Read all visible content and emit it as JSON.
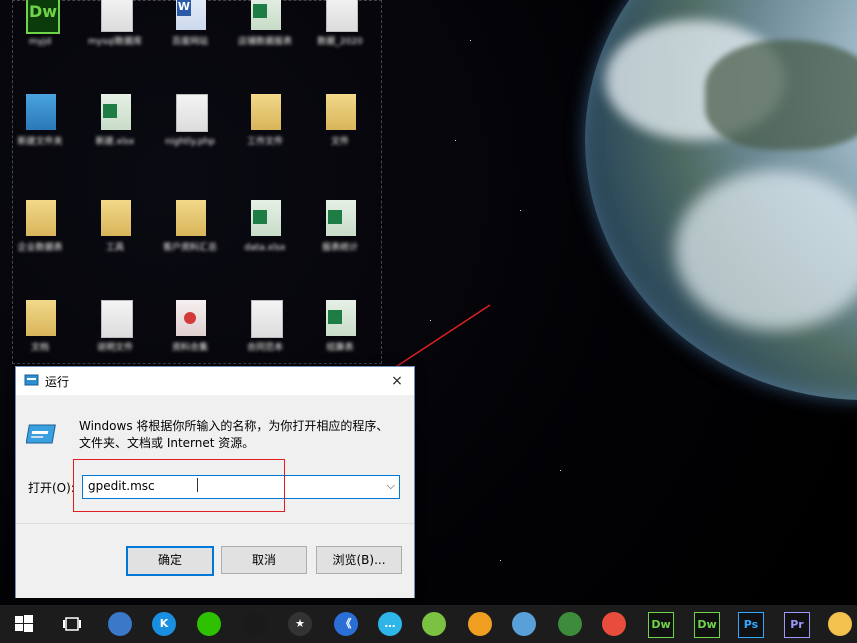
{
  "desktop": {
    "icons": [
      {
        "label": "myjd",
        "kind": "dw"
      },
      {
        "label": "mysql数据库",
        "kind": "doc"
      },
      {
        "label": "百度网站",
        "kind": "word"
      },
      {
        "label": "店铺数据报表",
        "kind": "xls"
      },
      {
        "label": "数据_2020",
        "kind": "doc"
      },
      {
        "label": "新建文件夹",
        "kind": "blue-folder"
      },
      {
        "label": "新建.xlsx",
        "kind": "xls"
      },
      {
        "label": "nightly.php",
        "kind": "doc"
      },
      {
        "label": "工作文件",
        "kind": "folder"
      },
      {
        "label": "文件",
        "kind": "folder"
      },
      {
        "label": "企业数据表",
        "kind": "folder"
      },
      {
        "label": "工具",
        "kind": "folder"
      },
      {
        "label": "客户资料汇总",
        "kind": "folder"
      },
      {
        "label": "data.xlsx",
        "kind": "xls"
      },
      {
        "label": "报表统计",
        "kind": "xls"
      },
      {
        "label": "文档",
        "kind": "folder"
      },
      {
        "label": "说明文件",
        "kind": "doc"
      },
      {
        "label": "资料合集",
        "kind": "pdf"
      },
      {
        "label": "合同范本",
        "kind": "doc"
      },
      {
        "label": "结算表",
        "kind": "xls"
      }
    ]
  },
  "run_dialog": {
    "title": "运行",
    "close": "×",
    "description": "Windows 将根据你所输入的名称，为你打开相应的程序、文件夹、文档或 Internet 资源。",
    "open_label": "打开(O):",
    "input_value": "gpedit.msc",
    "dropdown_arrow": "⌵",
    "ok_label": "确定",
    "cancel_label": "取消",
    "browse_label": "浏览(B)..."
  },
  "annotation": {
    "arrow_color": "#e02020",
    "box_color": "#e02020"
  },
  "taskbar": {
    "items": [
      {
        "name": "start-icon",
        "text": "",
        "color": "#ffffff"
      },
      {
        "name": "task-view-icon",
        "text": "",
        "color": "#ffffff"
      },
      {
        "name": "remote-desktop-icon",
        "text": "",
        "color": "#3a78c8"
      },
      {
        "name": "kugou-icon",
        "text": "K",
        "color": "#1a8fe0"
      },
      {
        "name": "wechat-icon",
        "text": "",
        "color": "#2dc100"
      },
      {
        "name": "qq-icon",
        "text": "",
        "color": "#1a1a1a"
      },
      {
        "name": "app-star-icon",
        "text": "★",
        "color": "#333333"
      },
      {
        "name": "back-app-icon",
        "text": "《",
        "color": "#2a6fd6"
      },
      {
        "name": "chat-icon",
        "text": "…",
        "color": "#2fb6e8"
      },
      {
        "name": "green-app-icon",
        "text": "",
        "color": "#7cc242"
      },
      {
        "name": "files-icon",
        "text": "",
        "color": "#f0a020"
      },
      {
        "name": "monitor-icon",
        "text": "",
        "color": "#5aa0d8"
      },
      {
        "name": "tools-icon",
        "text": "",
        "color": "#3c8c3c"
      },
      {
        "name": "tiles-icon",
        "text": "",
        "color": "#e84c3d"
      },
      {
        "name": "dreamweaver-icon",
        "text": "Dw",
        "color": "#6fd44a"
      },
      {
        "name": "dreamweaver2-icon",
        "text": "Dw",
        "color": "#6fd44a"
      },
      {
        "name": "photoshop-icon",
        "text": "Ps",
        "color": "#31a8ff"
      },
      {
        "name": "premiere-icon",
        "text": "Pr",
        "color": "#9999ff"
      },
      {
        "name": "mascot-icon",
        "text": "",
        "color": "#f2c14e"
      }
    ]
  }
}
